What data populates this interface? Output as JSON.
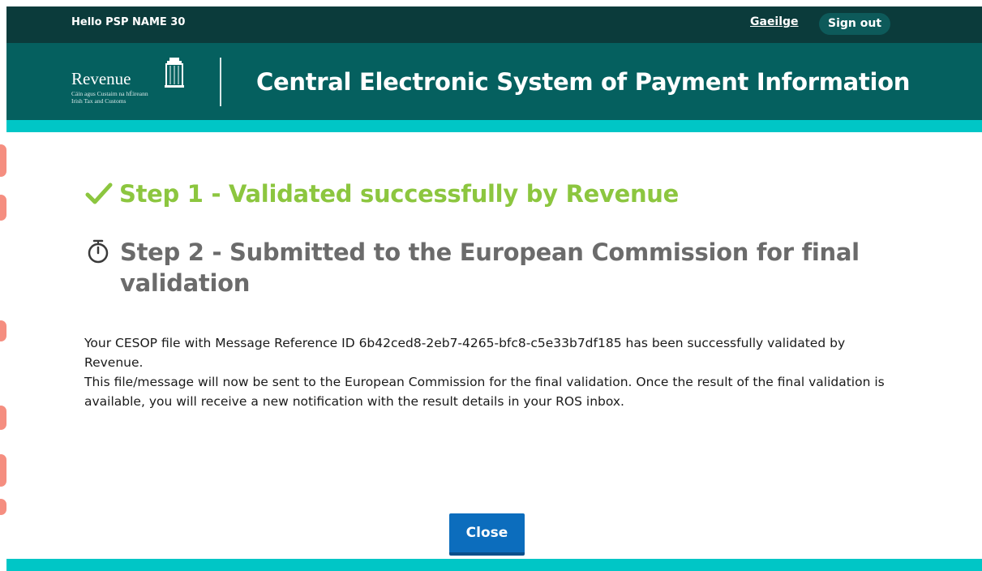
{
  "topbar": {
    "greeting": "Hello PSP NAME 30",
    "language_link": "Gaeilge",
    "sign_out": "Sign out"
  },
  "header": {
    "logo_word": "Revenue",
    "logo_sub1": "Cáin agus Custaim na hÉireann",
    "logo_sub2": "Irish Tax and Customs",
    "app_title": "Central Electronic System of Payment Information"
  },
  "status": {
    "step1": "Step 1 - Validated successfully by Revenue",
    "step2": "Step 2 - Submitted to the European Commission for final validation"
  },
  "message": {
    "line1": "Your CESOP file with Message Reference ID 6b42ced8-2eb7-4265-bfc8-c5e33b7df185 has been successfully validated by Revenue.",
    "line2": "This file/message will now be sent to the European Commission for the final validation. Once the result of the final validation is available, you will receive a new notification with the result details in your ROS inbox."
  },
  "actions": {
    "close": "Close"
  },
  "colors": {
    "topbar": "#0b3b3b",
    "header": "#05605f",
    "accent": "#00c6c6",
    "success": "#8cc63f",
    "pending": "#6b6b6b",
    "button": "#0c6dbd"
  },
  "icons": {
    "step1": "check-icon",
    "step2": "stopwatch-icon",
    "logo": "harp-icon"
  }
}
